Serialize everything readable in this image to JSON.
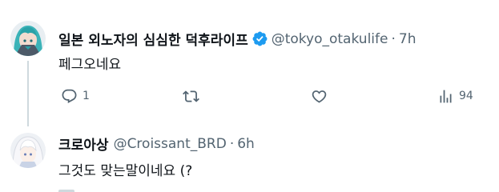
{
  "tweets": [
    {
      "author": {
        "display_name": "일본 외노자의 심심한 덕후라이프",
        "handle": "@tokyo_otakulife",
        "verified": true,
        "avatar": "avatar-teal-haired-character"
      },
      "separator": "·",
      "time": "7h",
      "text": "페그오네요",
      "actions": {
        "reply_count": "1",
        "retweet_count": "",
        "like_count": "",
        "views_count": "94"
      },
      "icons": {
        "reply": "reply-icon",
        "retweet": "retweet-icon",
        "like": "heart-icon",
        "views": "views-icon"
      }
    },
    {
      "author": {
        "display_name": "크로아상",
        "handle": "@Croissant_BRD",
        "verified": false,
        "avatar": "avatar-white-haired-character"
      },
      "separator": "·",
      "time": "6h",
      "text": "그것도 맞는말이네요 (?"
    }
  ],
  "colors": {
    "text_primary": "#0f1419",
    "text_secondary": "#536471",
    "verified_badge": "#1d9bf0",
    "thread_line": "#cfd9de",
    "background": "#ffffff"
  }
}
